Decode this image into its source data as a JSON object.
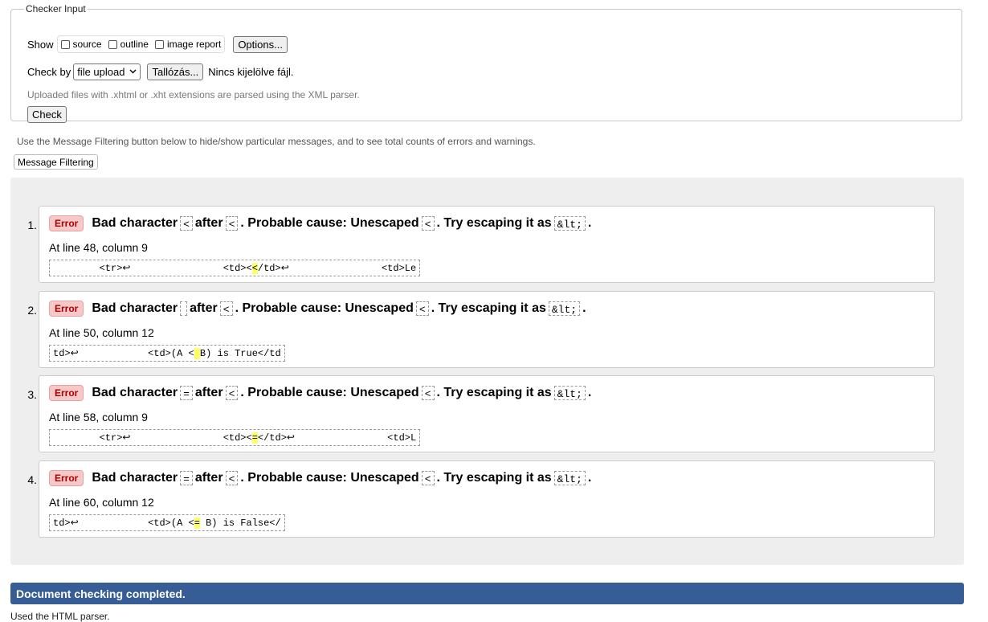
{
  "checker": {
    "legend": "Checker Input",
    "show_label": "Show",
    "options": [
      {
        "label": "source",
        "checked": false
      },
      {
        "label": "outline",
        "checked": false
      },
      {
        "label": "image report",
        "checked": false
      }
    ],
    "options_button": "Options...",
    "check_by_label": "Check by",
    "check_by_value": "file upload",
    "browse_button": "Tallózás...",
    "no_file_text": "Nincs kijelölve fájl.",
    "note": "Uploaded files with .xhtml or .xht extensions are parsed using the XML parser.",
    "check_button": "Check"
  },
  "filter_note": "Use the Message Filtering button below to hide/show particular messages, and to see total counts of errors and warnings.",
  "filter_button": "Message Filtering",
  "messages": [
    {
      "num": "1.",
      "badge": "Error",
      "t1": "Bad character",
      "c1": "<",
      "t2": "after",
      "c2": "<",
      "t3": ". Probable cause: Unescaped",
      "c3": "<",
      "t4": ". Try escaping it as",
      "c4": "&lt;",
      "t5": ".",
      "location": "At line 48, column 9",
      "ex_before": "        <tr>↩                <td><",
      "ex_hl": "<",
      "ex_after": "/td>↩                <td>Le"
    },
    {
      "num": "2.",
      "badge": "Error",
      "t1": "Bad character",
      "c1": " ",
      "t2": "after",
      "c2": "<",
      "t3": ". Probable cause: Unescaped",
      "c3": "<",
      "t4": ". Try escaping it as",
      "c4": "&lt;",
      "t5": ".",
      "location": "At line 50, column 12",
      "ex_before": "td>↩            <td>(A <",
      "ex_hl": " ",
      "ex_after": "B) is True</td"
    },
    {
      "num": "3.",
      "badge": "Error",
      "t1": "Bad character",
      "c1": "=",
      "t2": "after",
      "c2": "<",
      "t3": ". Probable cause: Unescaped",
      "c3": "<",
      "t4": ". Try escaping it as",
      "c4": "&lt;",
      "t5": ".",
      "location": "At line 58, column 9",
      "ex_before": "        <tr>↩                <td><",
      "ex_hl": "=",
      "ex_after": "</td>↩                <td>L"
    },
    {
      "num": "4.",
      "badge": "Error",
      "t1": "Bad character",
      "c1": "=",
      "t2": "after",
      "c2": "<",
      "t3": ". Probable cause: Unescaped",
      "c3": "<",
      "t4": ". Try escaping it as",
      "c4": "&lt;",
      "t5": ".",
      "location": "At line 60, column 12",
      "ex_before": "td>↩            <td>(A <",
      "ex_hl": "=",
      "ex_after": " B) is False</"
    }
  ],
  "completed": "Document checking completed.",
  "parser_note": "Used the HTML parser."
}
